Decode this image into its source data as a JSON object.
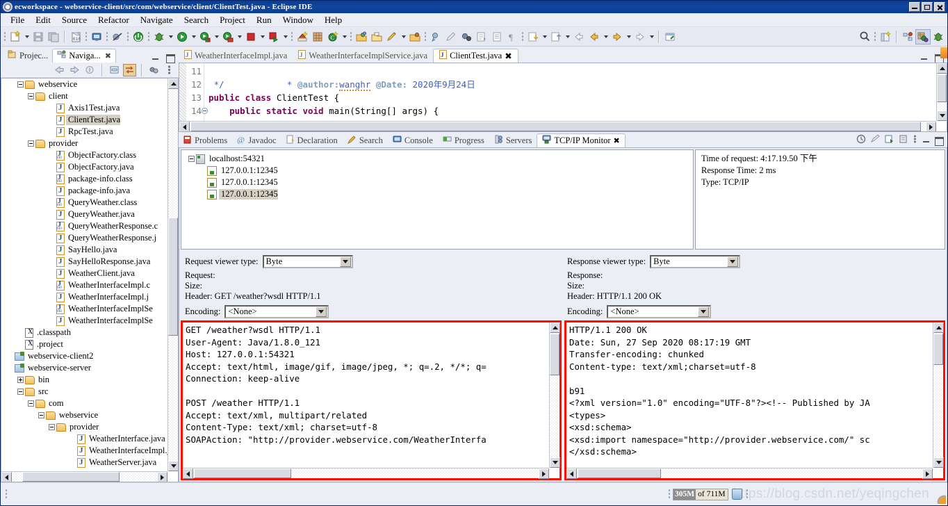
{
  "window": {
    "title": "ecworkspace - webservice-client/src/com/webservice/client/ClientTest.java - Eclipse IDE",
    "app_icon": "eclipse-icon",
    "minimize": "minimize-button",
    "maximize": "maximize-button",
    "close": "close-button"
  },
  "menubar": {
    "items": [
      "File",
      "Edit",
      "Source",
      "Refactor",
      "Navigate",
      "Search",
      "Project",
      "Run",
      "Window",
      "Help"
    ]
  },
  "toolbar": {
    "groups": [
      {
        "icons": [
          "new-wizard-icon",
          "dropdown-arrow",
          "save-icon",
          "save-all-icon"
        ]
      },
      {
        "icons": [
          "build-file-icon",
          "open-console-icon",
          "skip-breakpoints-icon"
        ]
      },
      {
        "icons": [
          "run-server-icon",
          "debug-icon",
          "dropdown-arrow",
          "run-icon",
          "dropdown-arrow",
          "run-external-tools-icon",
          "dropdown-arrow",
          "coverage-icon",
          "dropdown-arrow",
          "terminate-icon",
          "dropdown-arrow",
          "run-last-tool-icon",
          "dropdown-arrow"
        ]
      },
      {
        "icons": [
          "new-java-project-icon",
          "new-package-icon",
          "new-class-icon",
          "dropdown-arrow"
        ]
      },
      {
        "icons": [
          "open-type-icon",
          "open-task-icon",
          "edit-icon",
          "dropdown-arrow",
          "search-folder-icon"
        ]
      },
      {
        "icons": [
          "annotation-icon",
          "pencil-icon",
          "profile-icon",
          "next-edit-icon",
          "toggle-block-icon",
          "pilcrow-icon"
        ]
      },
      {
        "icons": [
          "next-annotation-icon",
          "dropdown-arrow",
          "previous-annotation-icon",
          "dropdown-arrow",
          "back-icon",
          "dropdown-arrow",
          "forward-icon",
          "dropdown-arrow",
          "link-icon"
        ]
      }
    ],
    "right_icons": [
      "search-icon",
      "new-perspective-icon",
      "java-ee-perspective-icon",
      "java-perspective-icon",
      "debug-perspective-icon"
    ]
  },
  "left_view": {
    "tabs": [
      {
        "label": "Projec...",
        "icon": "project-explorer-icon",
        "active": false
      },
      {
        "label": "Naviga...",
        "icon": "navigator-icon",
        "active": true,
        "close": "close-icon"
      }
    ],
    "toolbar_icons": [
      "back-icon",
      "forward-icon",
      "up-icon",
      "collapse-all-icon",
      "link-with-editor-icon",
      "view-menu-icon",
      "view-options-icon"
    ],
    "minimize": "minimize-view-button",
    "maximize": "maximize-view-button",
    "tree": [
      {
        "label": "webservice",
        "indent": 1,
        "icon": "folder",
        "twisty": "minus"
      },
      {
        "label": "client",
        "indent": 2,
        "icon": "folder",
        "twisty": "minus"
      },
      {
        "label": "Axis1Test.java",
        "indent": 4,
        "icon": "java"
      },
      {
        "label": "ClientTest.java",
        "indent": 4,
        "icon": "java",
        "selected": true
      },
      {
        "label": "RpcTest.java",
        "indent": 4,
        "icon": "java"
      },
      {
        "label": "provider",
        "indent": 2,
        "icon": "folder",
        "twisty": "minus"
      },
      {
        "label": "ObjectFactory.class",
        "indent": 4,
        "icon": "cls"
      },
      {
        "label": "ObjectFactory.java",
        "indent": 4,
        "icon": "java"
      },
      {
        "label": "package-info.class",
        "indent": 4,
        "icon": "cls"
      },
      {
        "label": "package-info.java",
        "indent": 4,
        "icon": "java"
      },
      {
        "label": "QueryWeather.class",
        "indent": 4,
        "icon": "cls"
      },
      {
        "label": "QueryWeather.java",
        "indent": 4,
        "icon": "java"
      },
      {
        "label": "QueryWeatherResponse.c",
        "indent": 4,
        "icon": "cls"
      },
      {
        "label": "QueryWeatherResponse.j",
        "indent": 4,
        "icon": "java"
      },
      {
        "label": "SayHello.java",
        "indent": 4,
        "icon": "java"
      },
      {
        "label": "SayHelloResponse.java",
        "indent": 4,
        "icon": "java"
      },
      {
        "label": "WeatherClient.java",
        "indent": 4,
        "icon": "java"
      },
      {
        "label": "WeatherInterfaceImpl.c",
        "indent": 4,
        "icon": "cls"
      },
      {
        "label": "WeatherInterfaceImpl.j",
        "indent": 4,
        "icon": "java"
      },
      {
        "label": "WeatherInterfaceImplSe",
        "indent": 4,
        "icon": "cls"
      },
      {
        "label": "WeatherInterfaceImplSe",
        "indent": 4,
        "icon": "java"
      },
      {
        "label": ".classpath",
        "indent": 1,
        "icon": "xfile"
      },
      {
        "label": ".project",
        "indent": 1,
        "icon": "xfile"
      },
      {
        "label": "webservice-client2",
        "indent": 0,
        "icon": "proj"
      },
      {
        "label": "webservice-server",
        "indent": 0,
        "icon": "proj"
      },
      {
        "label": "bin",
        "indent": 1,
        "icon": "folder",
        "twisty": "plus"
      },
      {
        "label": "src",
        "indent": 1,
        "icon": "folder",
        "twisty": "minus"
      },
      {
        "label": "com",
        "indent": 2,
        "icon": "folder",
        "twisty": "minus"
      },
      {
        "label": "webservice",
        "indent": 3,
        "icon": "folder",
        "twisty": "minus"
      },
      {
        "label": "provider",
        "indent": 4,
        "icon": "folder",
        "twisty": "minus"
      },
      {
        "label": "WeatherInterface.java",
        "indent": 6,
        "icon": "java"
      },
      {
        "label": "WeatherInterfaceImpl.j",
        "indent": 6,
        "icon": "java"
      },
      {
        "label": "WeatherServer.java",
        "indent": 6,
        "icon": "java"
      }
    ]
  },
  "editor": {
    "tabs": [
      {
        "label": "WeatherInterfaceImpl.java",
        "icon": "java-file-icon",
        "active": false
      },
      {
        "label": "WeatherInterfaceImplService.java",
        "icon": "java-file-icon",
        "active": false
      },
      {
        "label": "ClientTest.java",
        "icon": "java-file-icon",
        "active": true,
        "close": "close-icon"
      }
    ],
    "lines": [
      {
        "number": "11",
        "fold": false
      },
      {
        "number": "12",
        "fold": false
      },
      {
        "number": "13",
        "fold": false
      },
      {
        "number": "14",
        "fold": true
      }
    ],
    "code": {
      "l11_star": " * ",
      "l11_author": "@author:",
      "l11_name": "wanghr",
      "l11_date_tag": " @Date:",
      "l11_date": " 2020年9月24日",
      "l12": " */",
      "l13_kw": "public class ",
      "l13_name": "ClientTest {",
      "l14_kw1": "    public static void ",
      "l14_rest": "main(String[] args) {"
    }
  },
  "bottom_panel": {
    "tabs": [
      {
        "label": "Problems",
        "icon": "problems-icon",
        "active": false
      },
      {
        "label": "Javadoc",
        "icon": "javadoc-icon",
        "active": false
      },
      {
        "label": "Declaration",
        "icon": "declaration-icon",
        "active": false
      },
      {
        "label": "Search",
        "icon": "search-icon",
        "active": false
      },
      {
        "label": "Console",
        "icon": "console-icon",
        "active": false
      },
      {
        "label": "Progress",
        "icon": "progress-icon",
        "active": false
      },
      {
        "label": "Servers",
        "icon": "servers-icon",
        "active": false
      },
      {
        "label": "TCP/IP Monitor",
        "icon": "tcpip-monitor-icon",
        "active": true,
        "close": "close-icon"
      }
    ],
    "view_tools": [
      "history-icon",
      "clear-icon",
      "properties-icon",
      "pin-icon",
      "view-menu-icon",
      "minimize-icon",
      "maximize-icon"
    ]
  },
  "monitor": {
    "tree": [
      {
        "label": "localhost:54321",
        "indent": 0,
        "icon": "server",
        "twisty": "minus"
      },
      {
        "label": "127.0.0.1:12345",
        "indent": 1,
        "icon": "request"
      },
      {
        "label": "127.0.0.1:12345",
        "indent": 1,
        "icon": "request"
      },
      {
        "label": "127.0.0.1:12345",
        "indent": 1,
        "icon": "request",
        "selected": true
      }
    ],
    "info": {
      "time_of_request": "Time of request: 4:17.19.50 下午",
      "response_time": "Response Time: 2 ms",
      "type": "Type: TCP/IP"
    },
    "request": {
      "viewer_type_label": "Request viewer type:",
      "viewer_type_value": "Byte",
      "request_label": "Request:",
      "size_label": "Size:",
      "header_label": "Header: GET /weather?wsdl HTTP/1.1",
      "encoding_label": "Encoding:",
      "encoding_value": "<None>",
      "body": "GET /weather?wsdl HTTP/1.1\nUser-Agent: Java/1.8.0_121\nHost: 127.0.0.1:54321\nAccept: text/html, image/gif, image/jpeg, *; q=.2, */*; q=\nConnection: keep-alive\n\nPOST /weather HTTP/1.1\nAccept: text/xml, multipart/related\nContent-Type: text/xml; charset=utf-8\nSOAPAction: \"http://provider.webservice.com/WeatherInterfa"
    },
    "response": {
      "viewer_type_label": "Response viewer type:",
      "viewer_type_value": "Byte",
      "response_label": "Response:",
      "size_label": "Size:",
      "header_label": "Header: HTTP/1.1 200 OK",
      "encoding_label": "Encoding:",
      "encoding_value": "<None>",
      "body": "HTTP/1.1 200 OK\nDate: Sun, 27 Sep 2020 08:17:19 GMT\nTransfer-encoding: chunked\nContent-type: text/xml;charset=utf-8\n\nb91\n<?xml version=\"1.0\" encoding=\"UTF-8\"?><!-- Published by JA\n<types>\n<xsd:schema>\n<xsd:import namespace=\"http://provider.webservice.com/\" sc\n</xsd:schema>"
    }
  },
  "statusbar": {
    "heap_used": "305M",
    "heap_total": "of 711M",
    "trash_icon": "trash-icon",
    "watermark": "https://blog.csdn.net/yeqingchen"
  },
  "colors": {
    "title_bar": "#0a3d91",
    "chrome": "#eceef5",
    "highlight_border": "#ff0f00",
    "selection": "#d5d0c4",
    "keyword": "#7f0055",
    "javadoc": "#3f5fbf"
  }
}
